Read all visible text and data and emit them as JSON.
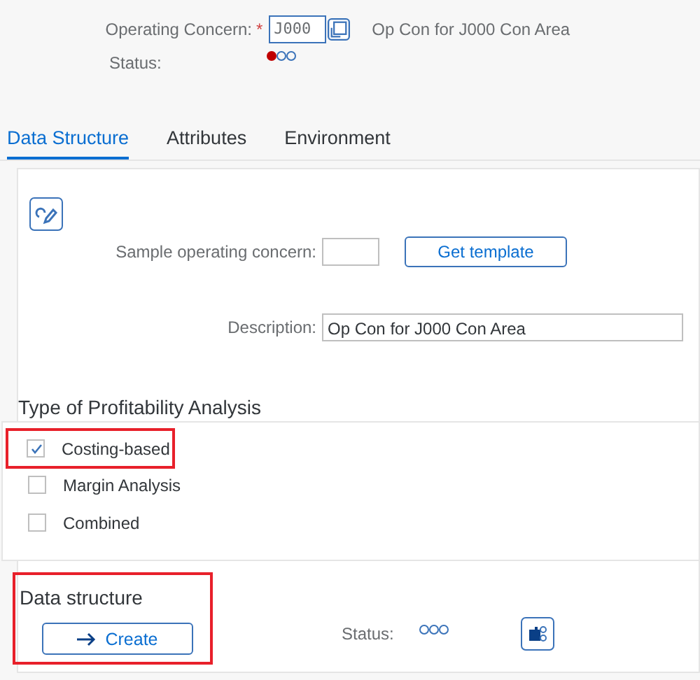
{
  "header": {
    "concern_label": "Operating Concern:",
    "required_mark": "*",
    "concern_value": "J000",
    "concern_text": "Op Con for J000 Con Area",
    "status_label": "Status:",
    "status_lights": [
      {
        "on": true
      },
      {
        "on": false
      },
      {
        "on": false
      }
    ]
  },
  "tabs": [
    {
      "label": "Data Structure",
      "selected": true
    },
    {
      "label": "Attributes",
      "selected": false
    },
    {
      "label": "Environment",
      "selected": false
    }
  ],
  "form": {
    "sample_label": "Sample operating concern:",
    "template_button": "Get template",
    "description_label": "Description:",
    "description_value": "Op Con for J000 Con Area"
  },
  "profitability": {
    "title": "Type of Profitability Analysis",
    "options": [
      {
        "label": "Costing-based",
        "checked": true,
        "highlighted": true
      },
      {
        "label": "Margin Analysis",
        "checked": false,
        "highlighted": false
      },
      {
        "label": "Combined",
        "checked": false,
        "highlighted": false
      }
    ]
  },
  "data_structure": {
    "title": "Data structure",
    "highlighted": true,
    "create_button": "Create",
    "status_label": "Status:",
    "status_lights": [
      {
        "on": false
      },
      {
        "on": false
      },
      {
        "on": false
      }
    ]
  }
}
